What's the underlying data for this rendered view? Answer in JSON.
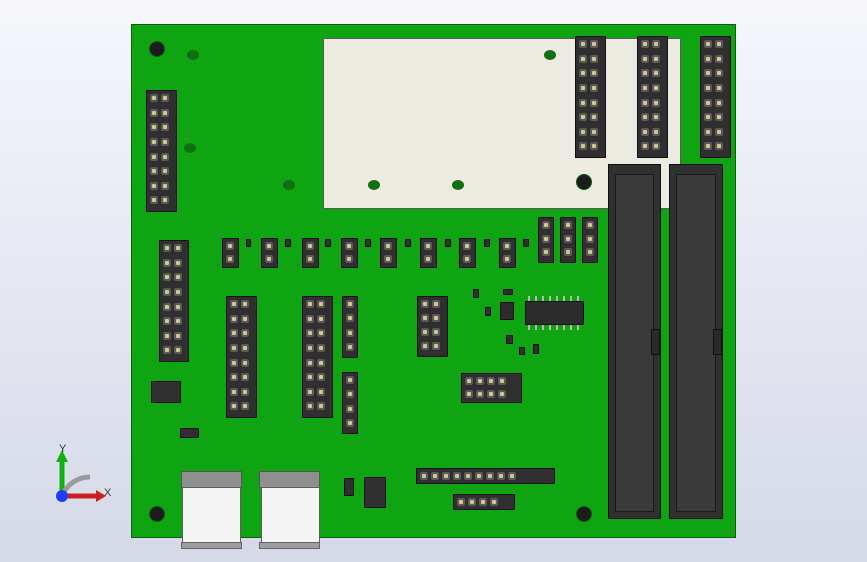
{
  "viewport": {
    "axis_labels": {
      "y": "Y",
      "x": "X"
    }
  },
  "colors": {
    "background_top": "#f6f7fb",
    "background_bottom": "#d5d9e8",
    "board": "#0fa512",
    "connector": "#2f2f2f",
    "label": "#ecebe2"
  },
  "icons": {
    "triad": "axis-triad-icon"
  }
}
